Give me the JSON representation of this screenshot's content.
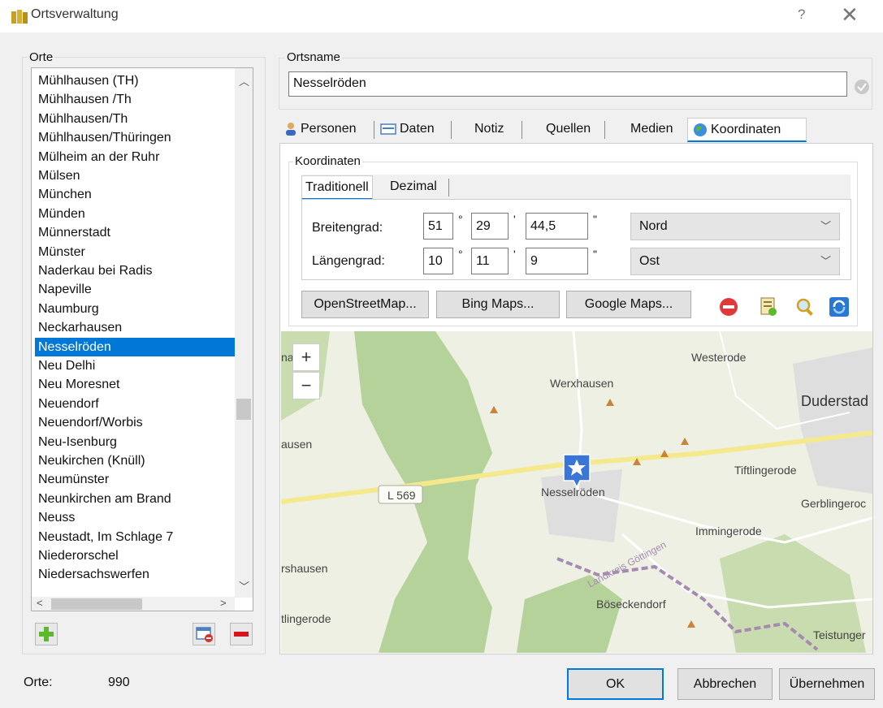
{
  "window": {
    "title": "Ortsverwaltung",
    "help_label": "?",
    "close_label": "✕"
  },
  "places": {
    "group_label": "Orte",
    "items": [
      "Mühlhausen (TH)",
      "Mühlhausen /Th",
      "Mühlhausen/Th",
      "Mühlhausen/Thüringen",
      "Mülheim an der Ruhr",
      "Mülsen",
      "München",
      "Münden",
      "Münnerstadt",
      "Münster",
      "Naderkau bei Radis",
      "Napeville",
      "Naumburg",
      "Neckarhausen",
      "Nesselröden",
      "Neu Delhi",
      "Neu Moresnet",
      "Neuendorf",
      "Neuendorf/Worbis",
      "Neu-Isenburg",
      "Neukirchen (Knüll)",
      "Neumünster",
      "Neunkirchen am Brand",
      "Neuss",
      "Neustadt, Im Schlage 7",
      "Niederorschel",
      "Niedersachswerfen"
    ],
    "selected": "Nesselröden",
    "count_label": "Orte:",
    "count_value": "990"
  },
  "place_name": {
    "label": "Ortsname",
    "value": "Nesselröden"
  },
  "tabs": [
    {
      "label": "Personen",
      "icon": "person-icon"
    },
    {
      "label": "Daten",
      "icon": "data-card-icon"
    },
    {
      "label": "Notiz"
    },
    {
      "label": "Quellen"
    },
    {
      "label": "Medien"
    },
    {
      "label": "Koordinaten",
      "icon": "globe-icon",
      "active": true
    }
  ],
  "coordinates": {
    "group_label": "Koordinaten",
    "subtabs": {
      "traditional": "Traditionell",
      "decimal": "Dezimal",
      "active": "Traditionell"
    },
    "latitude": {
      "label": "Breitengrad:",
      "deg": "51",
      "min": "29",
      "sec": "44,5",
      "direction": "Nord"
    },
    "longitude": {
      "label": "Längengrad:",
      "deg": "10",
      "min": "11",
      "sec": "9",
      "direction": "Ost"
    },
    "units": {
      "deg": "°",
      "min": "'",
      "sec": "\""
    },
    "map_buttons": {
      "osm": "OpenStreetMap...",
      "bing": "Bing Maps...",
      "google": "Google Maps..."
    }
  },
  "map": {
    "zoom_in": "+",
    "zoom_out": "−",
    "labels": {
      "westerode": "Westerode",
      "werxhausen": "Werxhausen",
      "duderstadt": "Duderstad",
      "usen": "ausen",
      "tiftlingerode": "Tiftlingerode",
      "road": "L 569",
      "nesselroeden": "Nesselröden",
      "gerblingerode": "Gerblingeroc",
      "immingerode": "Immingerode",
      "landkreis": "Landkreis Göttingen",
      "rshausen": "rshausen",
      "boeseckendorf": "Böseckendorf",
      "tlingerode": "tlingerode",
      "teistungen": "Teistunger",
      "na": "na"
    },
    "colors": {
      "forest": "#b5d29a",
      "road": "#f5e98d",
      "border": "#a58bb0",
      "marker": "#3a76d8"
    }
  },
  "buttons": {
    "ok": "OK",
    "cancel": "Abbrechen",
    "apply": "Übernehmen"
  },
  "accent": "#0078d7"
}
